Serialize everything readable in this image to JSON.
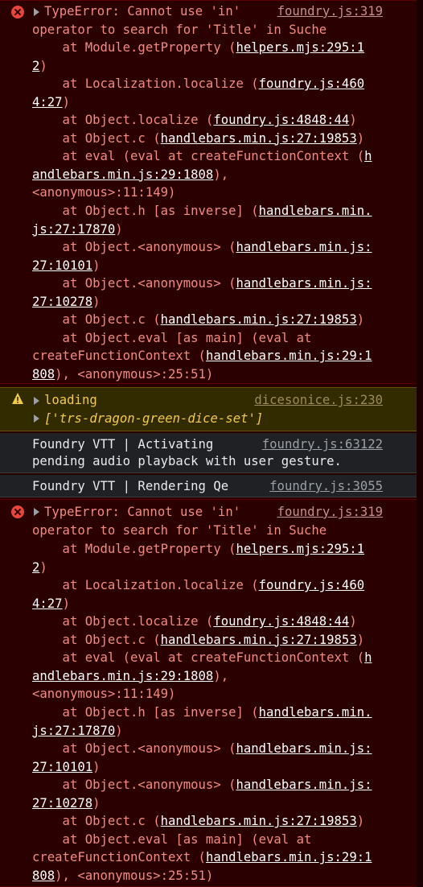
{
  "error1": {
    "message_l1": "TypeError: Cannot use 'in'",
    "message_l2": "operator to search for 'Title' in Suche",
    "source": "foundry.js:319",
    "stack": [
      {
        "pre": "    at Module.getProperty (",
        "link": "helpers.mjs:295:1",
        "post": ""
      },
      {
        "pre": "",
        "link": "2",
        "post": ")"
      },
      {
        "pre": "    at Localization.localize (",
        "link": "foundry.js:460",
        "post": ""
      },
      {
        "pre": "",
        "link": "4:27",
        "post": ")"
      },
      {
        "pre": "    at Object.localize (",
        "link": "foundry.js:4848:44",
        "post": ")"
      },
      {
        "pre": "    at Object.c (",
        "link": "handlebars.min.js:27:19853",
        "post": ")"
      },
      {
        "pre": "    at eval (eval at createFunctionContext (",
        "link": "h",
        "post": ""
      },
      {
        "pre": "",
        "link": "andlebars.min.js:29:1808",
        "post": "),"
      },
      {
        "pre": "<anonymous>:11:149)",
        "link": "",
        "post": ""
      },
      {
        "pre": "    at Object.h [as inverse] (",
        "link": "handlebars.min.",
        "post": ""
      },
      {
        "pre": "",
        "link": "js:27:17870",
        "post": ")"
      },
      {
        "pre": "    at Object.<anonymous> (",
        "link": "handlebars.min.js:",
        "post": ""
      },
      {
        "pre": "",
        "link": "27:10101",
        "post": ")"
      },
      {
        "pre": "    at Object.<anonymous> (",
        "link": "handlebars.min.js:",
        "post": ""
      },
      {
        "pre": "",
        "link": "27:10278",
        "post": ")"
      },
      {
        "pre": "    at Object.c (",
        "link": "handlebars.min.js:27:19853",
        "post": ")"
      },
      {
        "pre": "    at Object.eval [as main] (eval at",
        "link": "",
        "post": ""
      },
      {
        "pre": "createFunctionContext (",
        "link": "handlebars.min.js:29:1",
        "post": ""
      },
      {
        "pre": "",
        "link": "808",
        "post": "), <anonymous>:25:51)"
      }
    ]
  },
  "warn": {
    "label": "loading",
    "source": "dicesonice.js:230",
    "array_text": "['trs-dragon-green-dice-set']"
  },
  "info1": {
    "line1": "Foundry VTT | Activating",
    "line2": "pending audio playback with user gesture.",
    "source": "foundry.js:63122"
  },
  "info2": {
    "line1": "Foundry VTT | Rendering Qe",
    "source": "foundry.js:3055"
  },
  "error2": {
    "message_l1": "TypeError: Cannot use 'in'",
    "message_l2": "operator to search for 'Title' in Suche",
    "source": "foundry.js:319",
    "stack": [
      {
        "pre": "    at Module.getProperty (",
        "link": "helpers.mjs:295:1",
        "post": ""
      },
      {
        "pre": "",
        "link": "2",
        "post": ")"
      },
      {
        "pre": "    at Localization.localize (",
        "link": "foundry.js:460",
        "post": ""
      },
      {
        "pre": "",
        "link": "4:27",
        "post": ")"
      },
      {
        "pre": "    at Object.localize (",
        "link": "foundry.js:4848:44",
        "post": ")"
      },
      {
        "pre": "    at Object.c (",
        "link": "handlebars.min.js:27:19853",
        "post": ")"
      },
      {
        "pre": "    at eval (eval at createFunctionContext (",
        "link": "h",
        "post": ""
      },
      {
        "pre": "",
        "link": "andlebars.min.js:29:1808",
        "post": "),"
      },
      {
        "pre": "<anonymous>:11:149)",
        "link": "",
        "post": ""
      },
      {
        "pre": "    at Object.h [as inverse] (",
        "link": "handlebars.min.",
        "post": ""
      },
      {
        "pre": "",
        "link": "js:27:17870",
        "post": ")"
      },
      {
        "pre": "    at Object.<anonymous> (",
        "link": "handlebars.min.js:",
        "post": ""
      },
      {
        "pre": "",
        "link": "27:10101",
        "post": ")"
      },
      {
        "pre": "    at Object.<anonymous> (",
        "link": "handlebars.min.js:",
        "post": ""
      },
      {
        "pre": "",
        "link": "27:10278",
        "post": ")"
      },
      {
        "pre": "    at Object.c (",
        "link": "handlebars.min.js:27:19853",
        "post": ")"
      },
      {
        "pre": "    at Object.eval [as main] (eval at",
        "link": "",
        "post": ""
      },
      {
        "pre": "createFunctionContext (",
        "link": "handlebars.min.js:29:1",
        "post": ""
      },
      {
        "pre": "",
        "link": "808",
        "post": "), <anonymous>:25:51)"
      }
    ]
  }
}
